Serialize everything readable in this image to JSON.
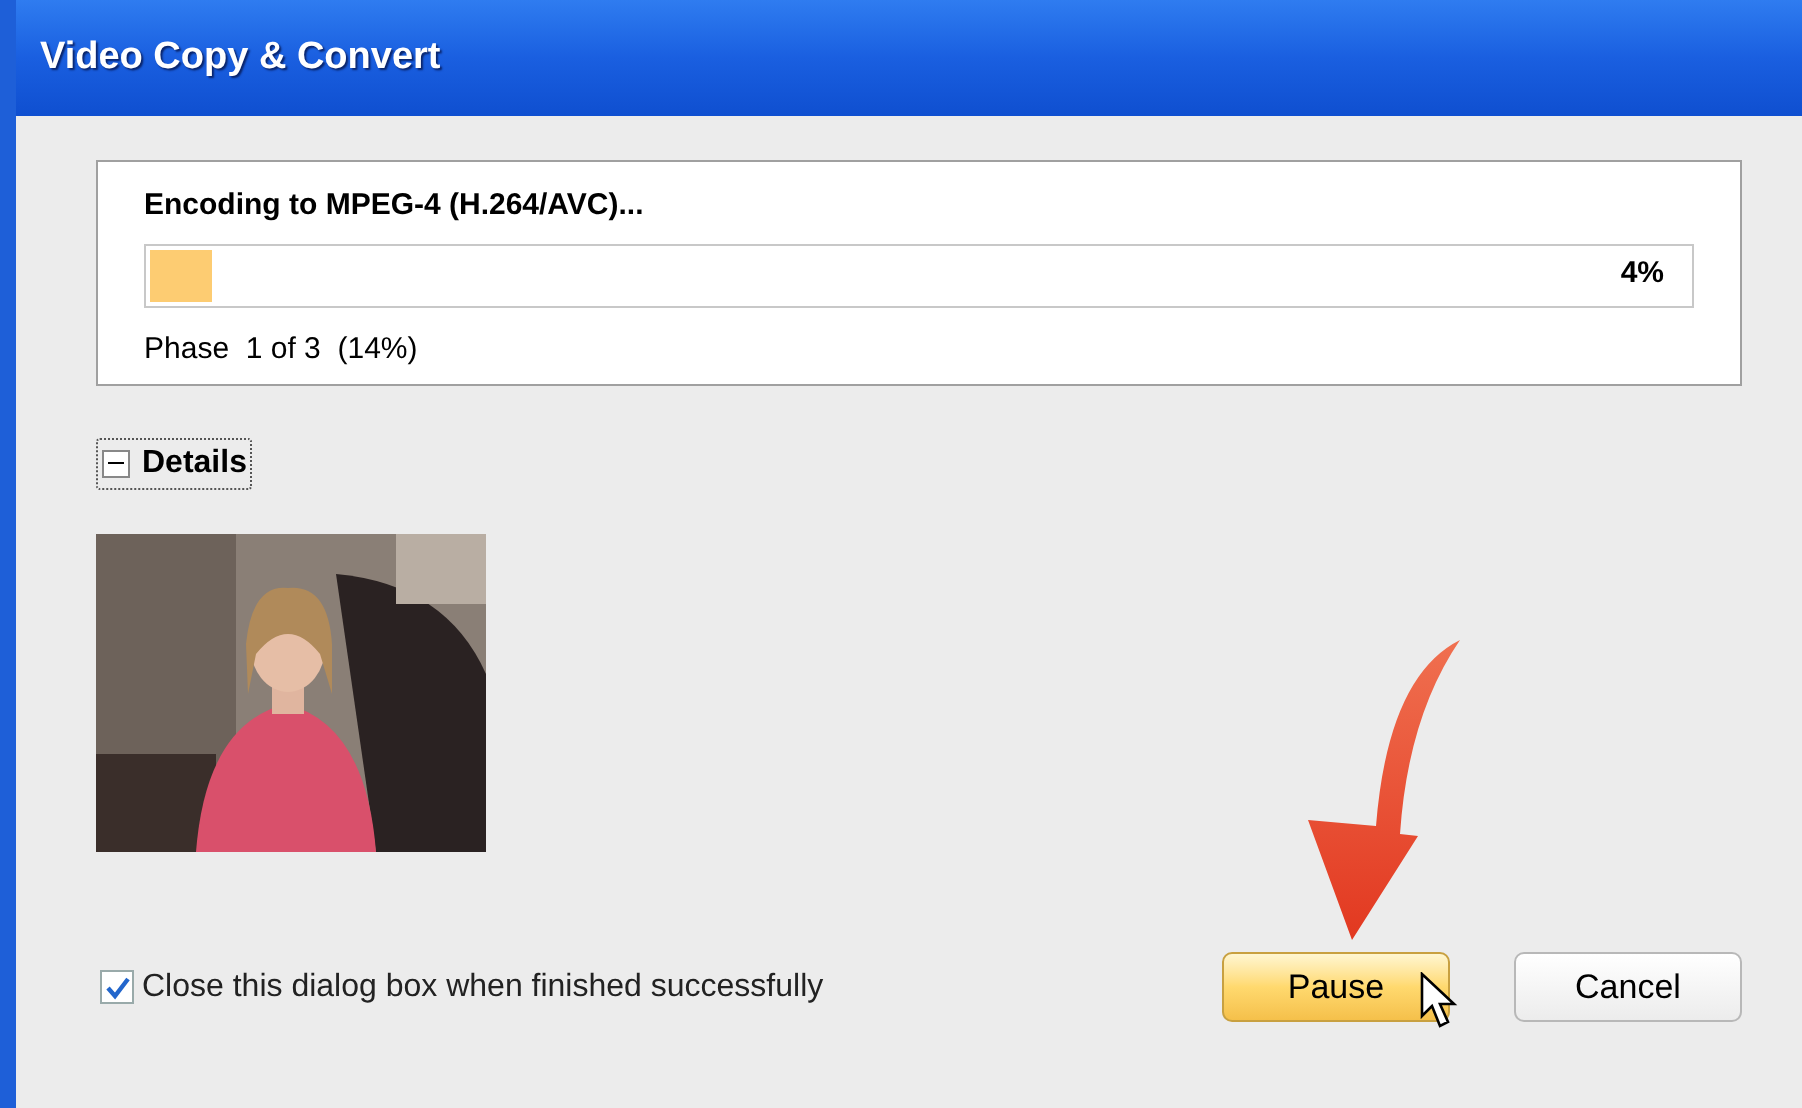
{
  "window": {
    "title": "Video Copy & Convert"
  },
  "progress": {
    "heading": "Encoding to MPEG-4 (H.264/AVC)...",
    "level": 0.04,
    "percent": "4%",
    "phase": "Phase  1 of 3  (14%)"
  },
  "details": {
    "label": "Details",
    "expanded": true
  },
  "close_option": {
    "label": "Close this dialog box when finished successfully",
    "checked": true
  },
  "buttons": [
    {
      "label": "Pause",
      "kind": "highlighted"
    },
    {
      "label": "Cancel",
      "kind": "normal"
    }
  ]
}
